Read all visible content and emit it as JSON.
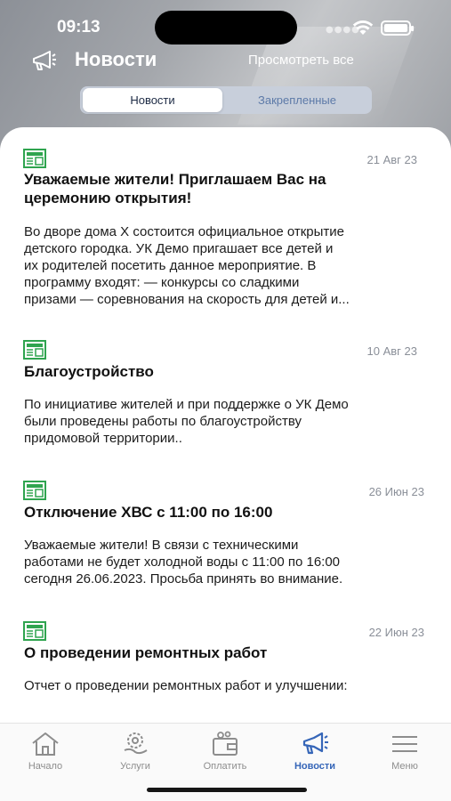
{
  "status": {
    "time": "09:13"
  },
  "header": {
    "title": "Новости",
    "view_all": "Просмотреть все"
  },
  "segments": {
    "active": "Новости",
    "inactive": "Закрепленные"
  },
  "news": [
    {
      "date": "21 Авг 23",
      "title_line1": "Уважаемые жители! Приглашаем Вас на",
      "title_line2": "церемонию открытия!",
      "body_line1": "Во дворе дома Х состоится официальное открытие",
      "body_line2": "детского городка. УК Демо пригашает все детей и",
      "body_line3": "их родителей посетить данное мероприятие. В",
      "body_line4": "программу входят: — конкурсы со сладкими",
      "body_line5": "призами — соревнования на скорость для детей и..."
    },
    {
      "date": "10 Авг 23",
      "title_line1": "Благоустройство",
      "body_line1": "По инициативе жителей и при поддержке о УК Демо",
      "body_line2": "были проведены работы по благоустройству",
      "body_line3": "придомовой территории.."
    },
    {
      "date": "26 Июн 23",
      "title_line1": "Отключение ХВС с 11:00 по 16:00",
      "body_line1": "Уважаемые жители! В связи с техническими",
      "body_line2": "работами не будет холодной воды с 11:00 по 16:00",
      "body_line3": "сегодня 26.06.2023. Просьба принять во внимание."
    },
    {
      "date": "22 Июн 23",
      "title_line1": "О проведении ремонтных работ",
      "body_line1": "Отчет о проведении ремонтных работ и улучшении:"
    }
  ],
  "tabbar": {
    "home": "Начало",
    "services": "Услуги",
    "pay": "Оплатить",
    "news": "Новости",
    "menu": "Меню"
  },
  "colors": {
    "accent": "#3666b8",
    "news_icon": "#2fa44f"
  }
}
